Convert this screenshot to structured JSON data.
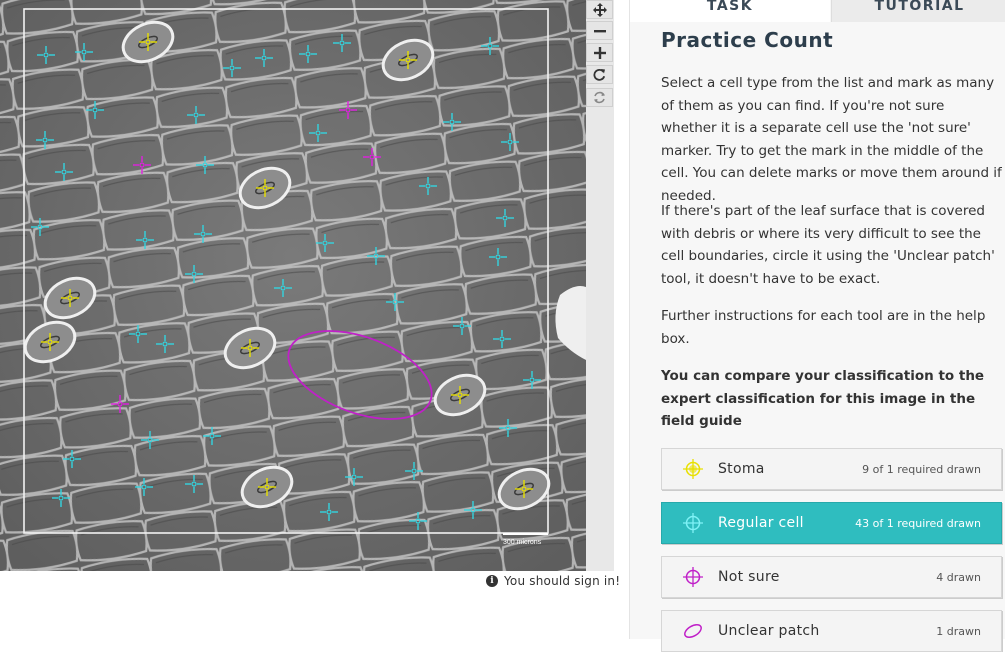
{
  "viewer": {
    "scale_label": "300 microns",
    "colors": {
      "stoma": "#e8e000",
      "regular": "#33d5e0",
      "notsure": "#e020e0",
      "unclear": "#c020c8"
    }
  },
  "controls": [
    {
      "name": "move-icon",
      "symbol": "move"
    },
    {
      "name": "zoom-out-icon",
      "symbol": "minus"
    },
    {
      "name": "zoom-in-icon",
      "symbol": "plus"
    },
    {
      "name": "rotate-icon",
      "symbol": "rotate"
    },
    {
      "name": "reset-icon",
      "symbol": "reset"
    }
  ],
  "signin": {
    "text": "You should sign in!",
    "icon": "info-icon"
  },
  "tabs": [
    {
      "label": "TASK",
      "active": true
    },
    {
      "label": "TUTORIAL",
      "active": false
    }
  ],
  "task": {
    "title": "Practice Count",
    "paragraphs": [
      "Select a cell type from the list and mark as many of them as you can find. If you're not sure whether it is a separate cell use the 'not sure' marker. Try to get the mark in the middle of the cell. You can delete marks or move them around if needed.",
      "If there's part of the leaf surface that is covered with debris or where its very difficult to see the cell boundaries, circle it using the 'Unclear patch' tool, it doesn't have to be exact.",
      "Further instructions for each tool are in the help box.",
      "You can compare your classification to the expert classification for this image in the field guide"
    ]
  },
  "tools": [
    {
      "label": "Stoma",
      "count": "9 of 1 required drawn",
      "color": "#e8e000",
      "icon": "crosshair-icon",
      "active": false
    },
    {
      "label": "Regular cell",
      "count": "43 of 1 required drawn",
      "color": "#33d5e0",
      "icon": "crosshair-icon",
      "active": true
    },
    {
      "label": "Not sure",
      "count": "4 drawn",
      "color": "#c020c8",
      "icon": "crosshair-icon",
      "active": false
    },
    {
      "label": "Unclear patch",
      "count": "1 drawn",
      "color": "#c020c8",
      "icon": "ellipse-icon",
      "active": false
    }
  ]
}
